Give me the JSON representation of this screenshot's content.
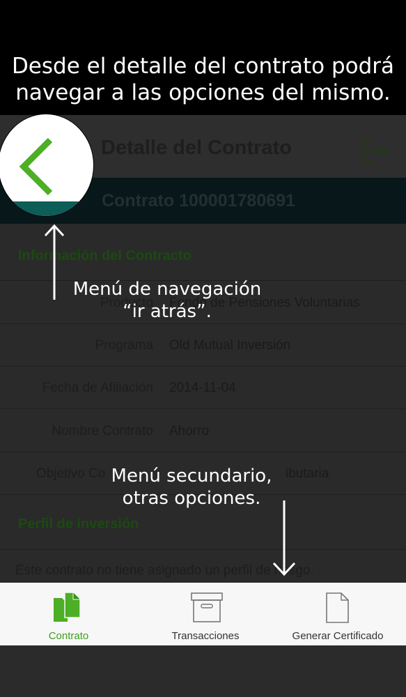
{
  "banner": {
    "line1": "Desde el detalle del contrato podrá",
    "line2": "navegar a las opciones del mismo."
  },
  "header": {
    "title": "Detalle del Contrato"
  },
  "contract": {
    "label": "Contrato 100001780691"
  },
  "info": {
    "section_title": "Información del Contracto",
    "rows": [
      {
        "label": "Producto",
        "value": "Fondo de Pensiones Voluntarias"
      },
      {
        "label": "Programa",
        "value": "Old Mutual Inversión"
      },
      {
        "label": "Fecha de Afiliación",
        "value": "2014-11-04"
      },
      {
        "label": "Nombre Contrato",
        "value": "Ahorro"
      },
      {
        "label": "Objetivo Co",
        "value": "ibutaria"
      }
    ]
  },
  "perfil": {
    "section_title": "Perfil de inversión",
    "text": "Este contrato no tiene asignado un perfil de riesgo."
  },
  "annotations": {
    "back": {
      "line1": "Menú de navegación",
      "line2": "“ir atrás”."
    },
    "secondary": {
      "line1": "Menú secundario,",
      "line2": "otras opciones."
    }
  },
  "tabs": [
    {
      "label": "Contrato",
      "icon": "documents-icon",
      "active": true
    },
    {
      "label": "Transacciones",
      "icon": "archive-box-icon",
      "active": false
    },
    {
      "label": "Generar Certificado",
      "icon": "document-icon",
      "active": false
    }
  ],
  "colors": {
    "accent": "#4caf25",
    "teal": "#0c5e57",
    "overlay": "#000000"
  }
}
